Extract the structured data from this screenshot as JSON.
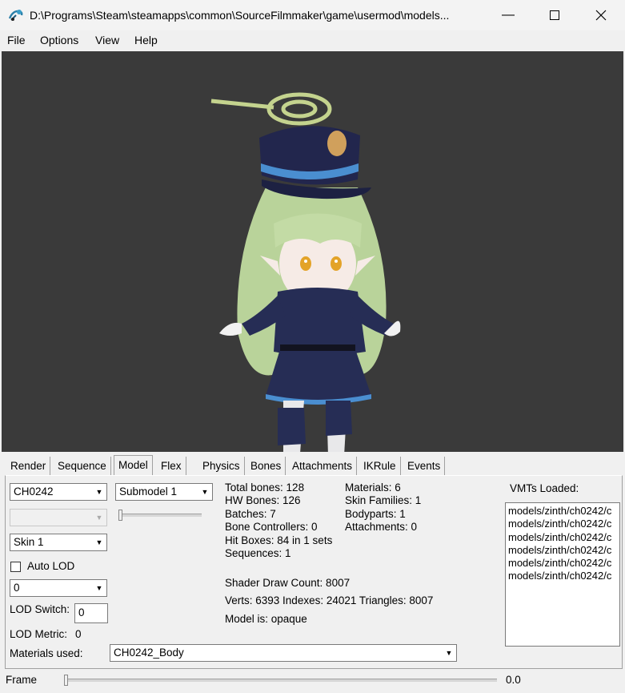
{
  "window": {
    "title": "D:\\Programs\\Steam\\steamapps\\common\\SourceFilmmaker\\game\\usermod\\models...",
    "minimize_glyph": "—",
    "maximize_glyph": "☐",
    "close_glyph": "✕"
  },
  "menu": {
    "file": "File",
    "options": "Options",
    "view": "View",
    "help": "Help"
  },
  "tabs": {
    "render": "Render",
    "sequence": "Sequence",
    "model": "Model",
    "flex": "Flex",
    "physics": "Physics",
    "bones": "Bones",
    "attachments": "Attachments",
    "ikrule": "IKRule",
    "events": "Events"
  },
  "model_panel": {
    "model_select": "CH0242",
    "submodel_select": "Submodel 1",
    "disabled_select": "",
    "skin_select": "Skin 1",
    "auto_lod_label": "Auto LOD",
    "lod_select": "0",
    "lod_switch_label": "LOD Switch:",
    "lod_switch_value": "0",
    "lod_metric_label": "LOD Metric:",
    "lod_metric_value": "0",
    "materials_used_label": "Materials used:",
    "materials_used_value": "CH0242_Body",
    "vmts_label": "VMTs Loaded:",
    "vmts": [
      "models/zinth/ch0242/c",
      "models/zinth/ch0242/c",
      "models/zinth/ch0242/c",
      "models/zinth/ch0242/c",
      "models/zinth/ch0242/c",
      "models/zinth/ch0242/c"
    ],
    "stats_left": [
      "Total bones: 128",
      "HW Bones: 126",
      "Batches: 7",
      "Bone Controllers: 0",
      "Hit Boxes: 84 in 1 sets",
      "Sequences: 1"
    ],
    "stats_right": [
      "Materials: 6",
      "Skin Families: 1",
      "Bodyparts: 1",
      "Attachments: 0"
    ],
    "shader_draw_count": "Shader Draw Count: 8007",
    "verts_line": "Verts: 6393  Indexes: 24021  Triangles: 8007",
    "model_is": "Model is: opaque"
  },
  "status": {
    "frame_label": "Frame",
    "frame_value": "0.0"
  },
  "icons": {
    "app": "steam-logo-icon",
    "dropdown": "chevron-down-icon"
  },
  "colors": {
    "viewport_bg": "#3a3a3a",
    "panel_bg": "#f0f0f0"
  }
}
